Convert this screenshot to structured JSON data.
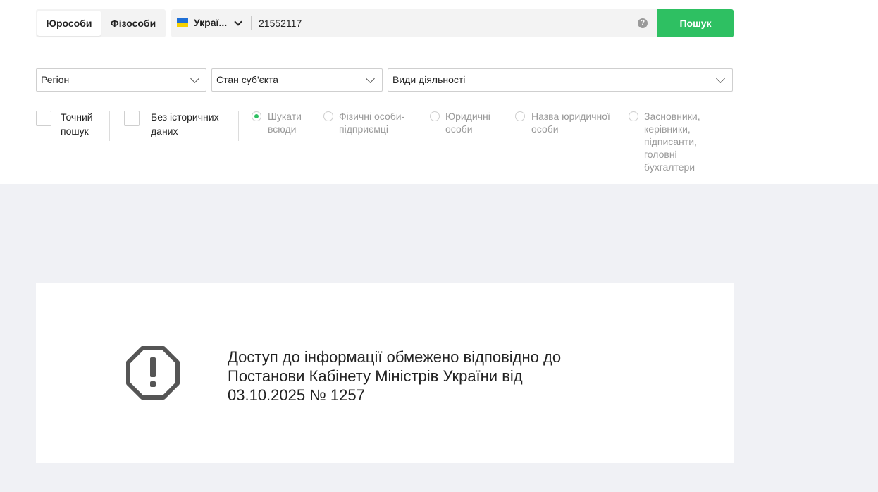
{
  "entity_toggle": {
    "legal_label": "Юрособи",
    "individual_label": "Фізособи"
  },
  "search": {
    "country_label": "Украї...",
    "country_flag": "ukraine-flag-icon",
    "value": "21552117",
    "help_icon": "question-circle-icon",
    "button_label": "Пошук",
    "button_color": "#2ec062"
  },
  "filters": {
    "region": "Регіон",
    "state": "Стан суб'єкта",
    "activity": "Види діяльності"
  },
  "options": {
    "exact_search": "Точний пошук",
    "no_history": "Без історичних даних"
  },
  "radios": [
    {
      "label": "Шукати всюди",
      "checked": true
    },
    {
      "label": "Фізичні особи-підприємці",
      "checked": false
    },
    {
      "label": "Юридичні особи",
      "checked": false
    },
    {
      "label": "Назва юридичної особи",
      "checked": false
    },
    {
      "label": "Засновники, керівники, підписанти, головні бухгалтери",
      "checked": false
    }
  ],
  "notice": {
    "icon": "octagon-exclamation-icon",
    "text": "Доступ до інформації обмежено відповідно до Постанови Кабінету Міністрів України від 03.10.2025 № 1257"
  }
}
